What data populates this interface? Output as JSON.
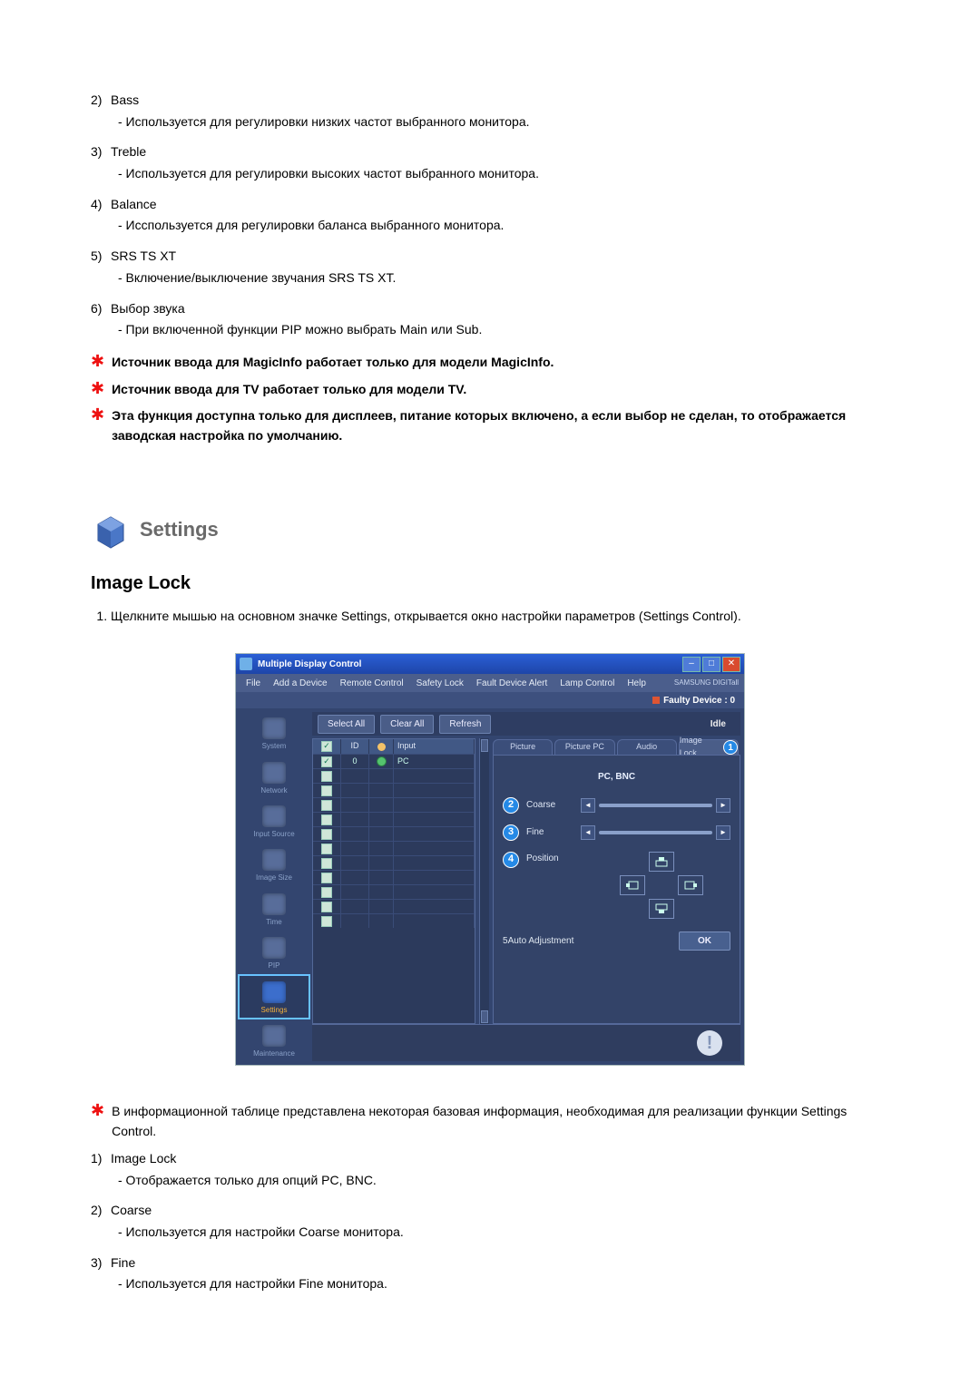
{
  "upper_list": [
    {
      "num": "2)",
      "label": "Bass",
      "desc": "- Используется для регулировки низких частот выбранного монитора."
    },
    {
      "num": "3)",
      "label": "Treble",
      "desc": "- Используется для регулировки высоких частот выбранного монитора."
    },
    {
      "num": "4)",
      "label": "Balance",
      "desc": "- Исспользуется для регулировки баланса выбранного монитора."
    },
    {
      "num": "5)",
      "label": "SRS TS XT",
      "desc": "- Включение/выключение звучания SRS TS XT."
    },
    {
      "num": "6)",
      "label": "Выбор звука",
      "desc": "- При включенной функции PIP можно выбрать Main или Sub."
    }
  ],
  "star_notes_top": [
    "Источник ввода для MagicInfo работает только для модели MagicInfo.",
    "Источник ввода для TV работает только для модели TV.",
    "Эта функция доступна только для дисплеев, питание которых включено, а если выбор не сделан, то отображается заводская настройка по умолчанию."
  ],
  "section_title": "Settings",
  "sub_title": "Image Lock",
  "instruction": "Щелкните мышью на основном значке Settings, открывается окно настройки параметров (Settings Control).",
  "shot": {
    "title": "Multiple Display Control",
    "menus": [
      "File",
      "Add a Device",
      "Remote Control",
      "Safety Lock",
      "Fault Device Alert",
      "Lamp Control",
      "Help"
    ],
    "brand": "SAMSUNG DIGITall",
    "faulty": "Faulty Device : 0",
    "buttons": {
      "select_all": "Select All",
      "clear_all": "Clear All",
      "refresh": "Refresh",
      "idle": "Idle"
    },
    "side": [
      "System",
      "Network",
      "Input Source",
      "Image Size",
      "Time",
      "PIP",
      "Settings",
      "Maintenance"
    ],
    "table": {
      "headers": [
        "",
        "ID",
        "",
        "Input"
      ],
      "rows": [
        {
          "id": "0",
          "input": "PC"
        }
      ]
    },
    "tabs": [
      "Picture",
      "Picture PC",
      "Audio",
      "Image Lock"
    ],
    "panel": {
      "header": "PC, BNC",
      "coarse": "Coarse",
      "fine": "Fine",
      "position": "Position",
      "auto": "Auto Adjustment",
      "ok": "OK",
      "callouts": {
        "tab": "1",
        "coarse": "2",
        "fine": "3",
        "position": "4",
        "auto": "5"
      }
    }
  },
  "star_notes_bottom": [
    "В информационной таблице представлена некоторая базовая информация, необходимая для реализации функции Settings Control."
  ],
  "lower_list": [
    {
      "num": "1)",
      "label": "Image Lock",
      "desc": "- Отображается только для опций PC, BNC."
    },
    {
      "num": "2)",
      "label": "Coarse",
      "desc": "- Используется для настройки Coarse монитора."
    },
    {
      "num": "3)",
      "label": "Fine",
      "desc": "- Используется для настройки Fine монитора."
    }
  ]
}
